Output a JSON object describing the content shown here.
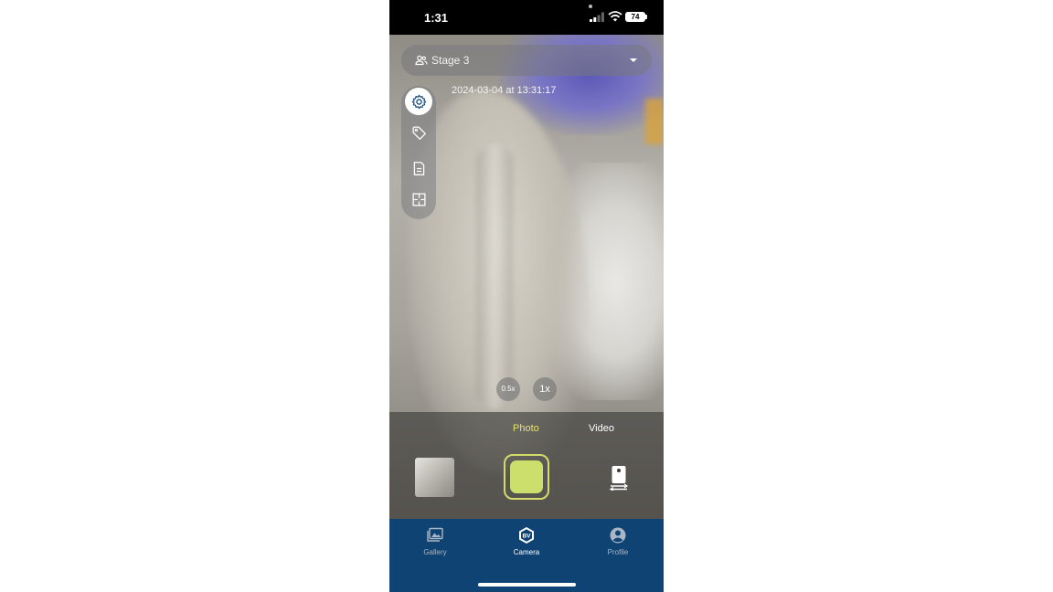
{
  "status_bar": {
    "time": "1:31",
    "battery": "74",
    "icons": [
      "signal-icon",
      "wifi-icon",
      "battery-icon"
    ]
  },
  "stage_selector": {
    "label": "Stage 3",
    "icon": "people-icon",
    "caret": "chevron-down-icon"
  },
  "timestamp": "2024-03-04 at 13:31:17",
  "tools": [
    {
      "name": "settings",
      "icon": "gear-icon",
      "active": true
    },
    {
      "name": "tag",
      "icon": "tag-icon",
      "active": false
    },
    {
      "name": "note",
      "icon": "document-icon",
      "active": false
    },
    {
      "name": "layout",
      "icon": "floorplan-icon",
      "active": false
    }
  ],
  "zoom": {
    "options": [
      "0.5x",
      "1x"
    ]
  },
  "capture": {
    "modes": [
      "Photo",
      "Video"
    ],
    "selected_mode": "Photo",
    "flip_icon": "flip-camera-icon"
  },
  "tabbar": {
    "gallery": "Gallery",
    "camera": "Camera",
    "camera_badge": "BV",
    "profile": "Profile",
    "active": "Camera"
  },
  "colors": {
    "accent": "#ccdf6c",
    "mode_active": "#e7e36a",
    "tabbar_bg": "#0e4374"
  }
}
